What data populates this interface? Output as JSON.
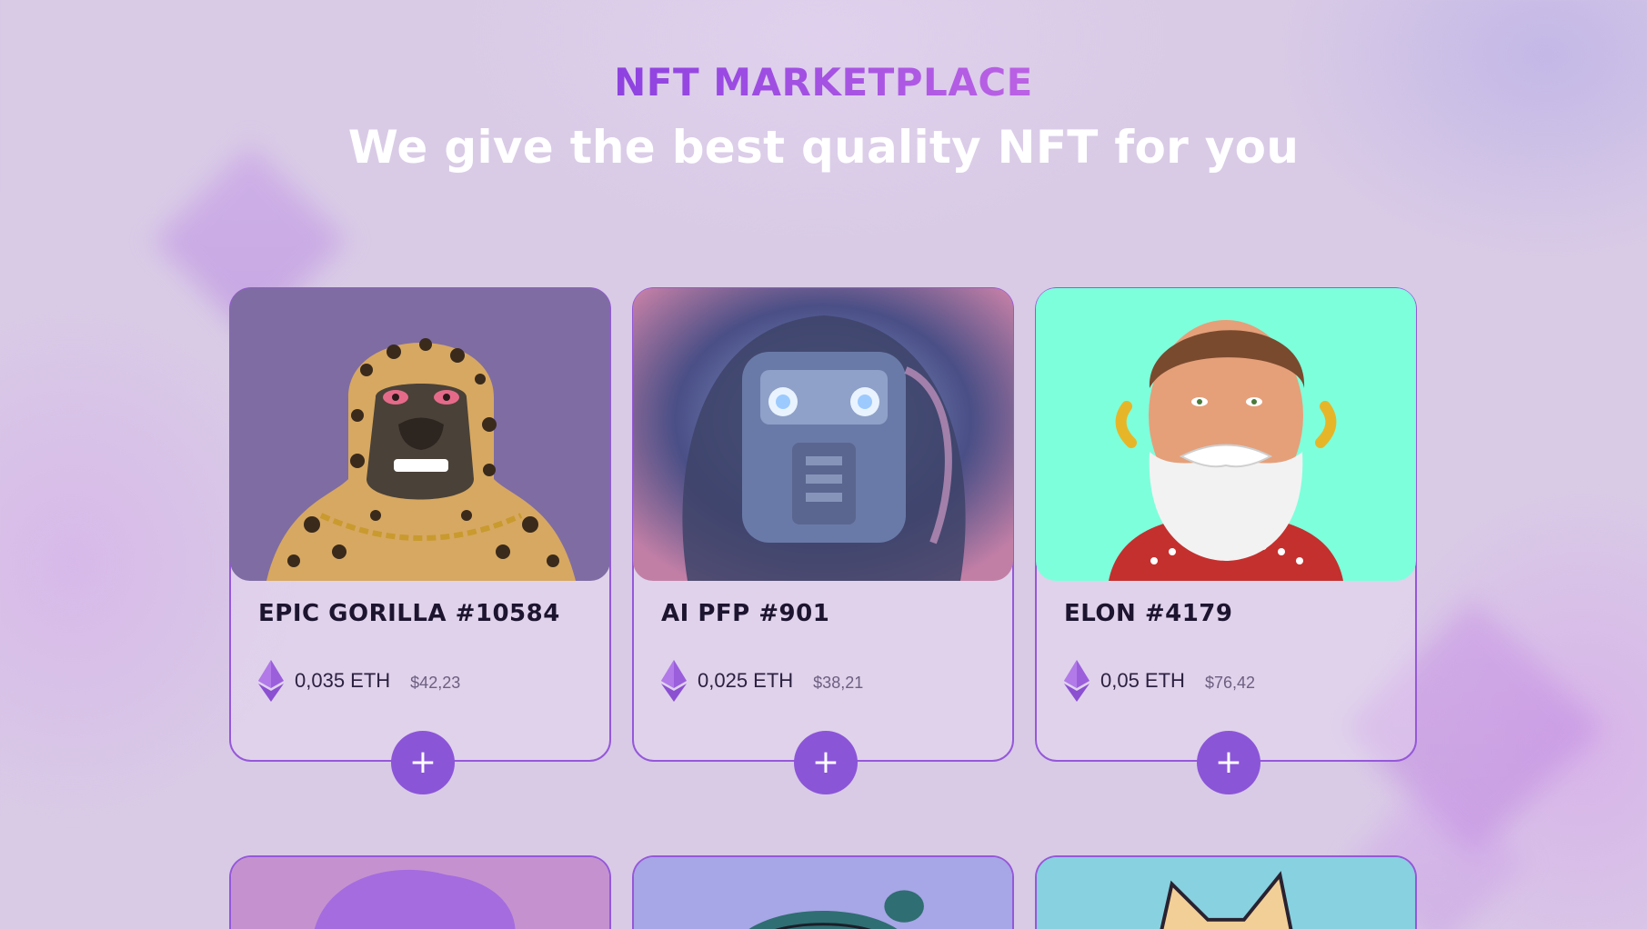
{
  "header": {
    "eyebrow": "NFT MARKETPLACE",
    "headline": "We give the best quality NFT for you"
  },
  "colors": {
    "accent": "#8b55d8",
    "card_border": "#9558d9",
    "headline": "#ffffff",
    "eyebrow_start": "#5a2ad6",
    "eyebrow_end": "#e195ea"
  },
  "cards": [
    {
      "name": "EPIC GORILLA #10584",
      "eth": "0,035 ETH",
      "usd": "$42,23",
      "art_bg": "#7f6ca3",
      "art_icon": "leopard-gorilla-art"
    },
    {
      "name": "AI PFP #901",
      "eth": "0,025 ETH",
      "usd": "$38,21",
      "art_bg": "#5c5f8f",
      "art_icon": "robot-face-art"
    },
    {
      "name": "ELON #4179",
      "eth": "0,05 ETH",
      "usd": "$76,42",
      "art_bg": "#7effdc",
      "art_icon": "bearded-man-art"
    }
  ],
  "partial_cards": [
    {
      "art_bg": "#c592cf",
      "art_icon": "purple-hair-art"
    },
    {
      "art_bg": "#a7a6e6",
      "art_icon": "teal-hair-art"
    },
    {
      "art_bg": "#87d1e0",
      "art_icon": "cat-art"
    }
  ],
  "icons": {
    "currency": "ethereum-icon",
    "add": "plus-icon"
  }
}
